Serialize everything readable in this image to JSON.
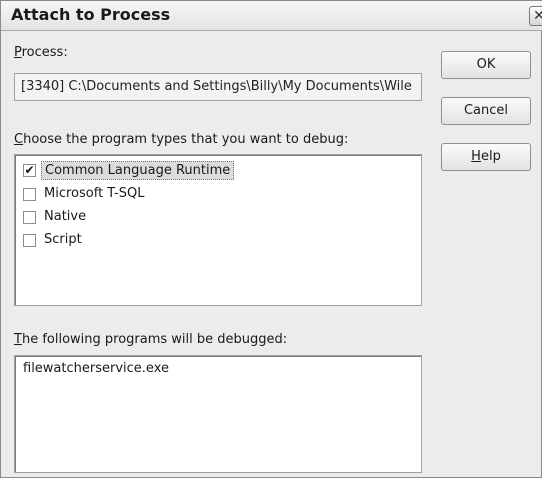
{
  "window": {
    "title": "Attach to Process",
    "close_glyph": "✕"
  },
  "process": {
    "label_access": "P",
    "label_rest": "rocess:",
    "value": "[3340] C:\\Documents and Settings\\Billy\\My Documents\\Wile"
  },
  "program_types": {
    "label_access": "C",
    "label_rest": "hoose the program types that you want to debug:",
    "items": [
      {
        "label": "Common Language Runtime",
        "checked": true,
        "mark": "✔"
      },
      {
        "label": "Microsoft T-SQL",
        "checked": false,
        "mark": ""
      },
      {
        "label": "Native",
        "checked": false,
        "mark": ""
      },
      {
        "label": "Script",
        "checked": false,
        "mark": ""
      }
    ]
  },
  "debugged": {
    "label_access": "T",
    "label_rest": "he following programs will be debugged:",
    "value": "filewatcherservice.exe"
  },
  "buttons": {
    "ok": "OK",
    "cancel": "Cancel",
    "help_access": "H",
    "help_rest": "elp"
  }
}
